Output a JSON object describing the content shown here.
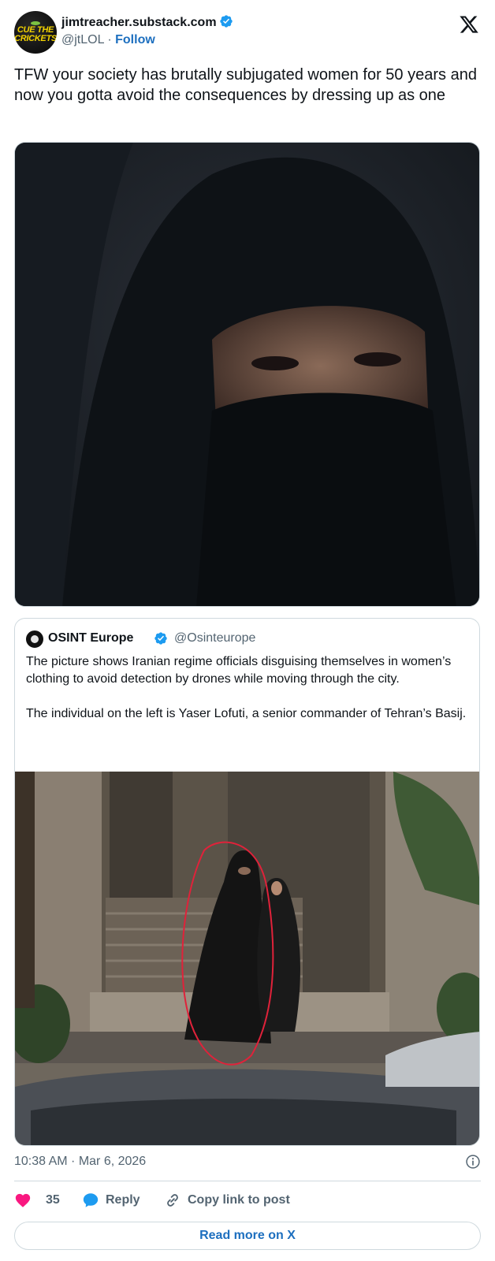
{
  "author": {
    "avatar_text_top": "CUE THE",
    "avatar_text_bottom": "CRICKETS",
    "name": "jimtreacher.substack.com",
    "handle": "@jtLOL",
    "separator": "·",
    "follow_label": "Follow",
    "verified_icon": "verified-badge-icon"
  },
  "platform_icon": "x-logo-icon",
  "tweet": {
    "text": "TFW your society has brutally subjugated women for 50 years and now you gotta avoid the consequences by dressing up as one"
  },
  "quoted_tweet": {
    "name": "OSINT Europe",
    "handle": "@Osinteurope",
    "paragraphs": [
      "The picture shows Iranian regime officials disguising themselves in women’s clothing to avoid detection by drones while moving through the city.",
      "The individual on the left is Yaser Lofuti, a senior commander of Tehran’s Basij."
    ]
  },
  "meta": {
    "timestamp": "10:38 AM · Mar 6, 2026"
  },
  "actions": {
    "like_count": "35",
    "reply_label": "Reply",
    "copy_label": "Copy link to post"
  },
  "read_more_label": "Read more on X",
  "colors": {
    "link_blue": "#1d6fbf",
    "verified_blue": "#1d9bf0",
    "like_pink": "#f91880",
    "muted_text": "#536471",
    "border": "#cfd9de"
  }
}
